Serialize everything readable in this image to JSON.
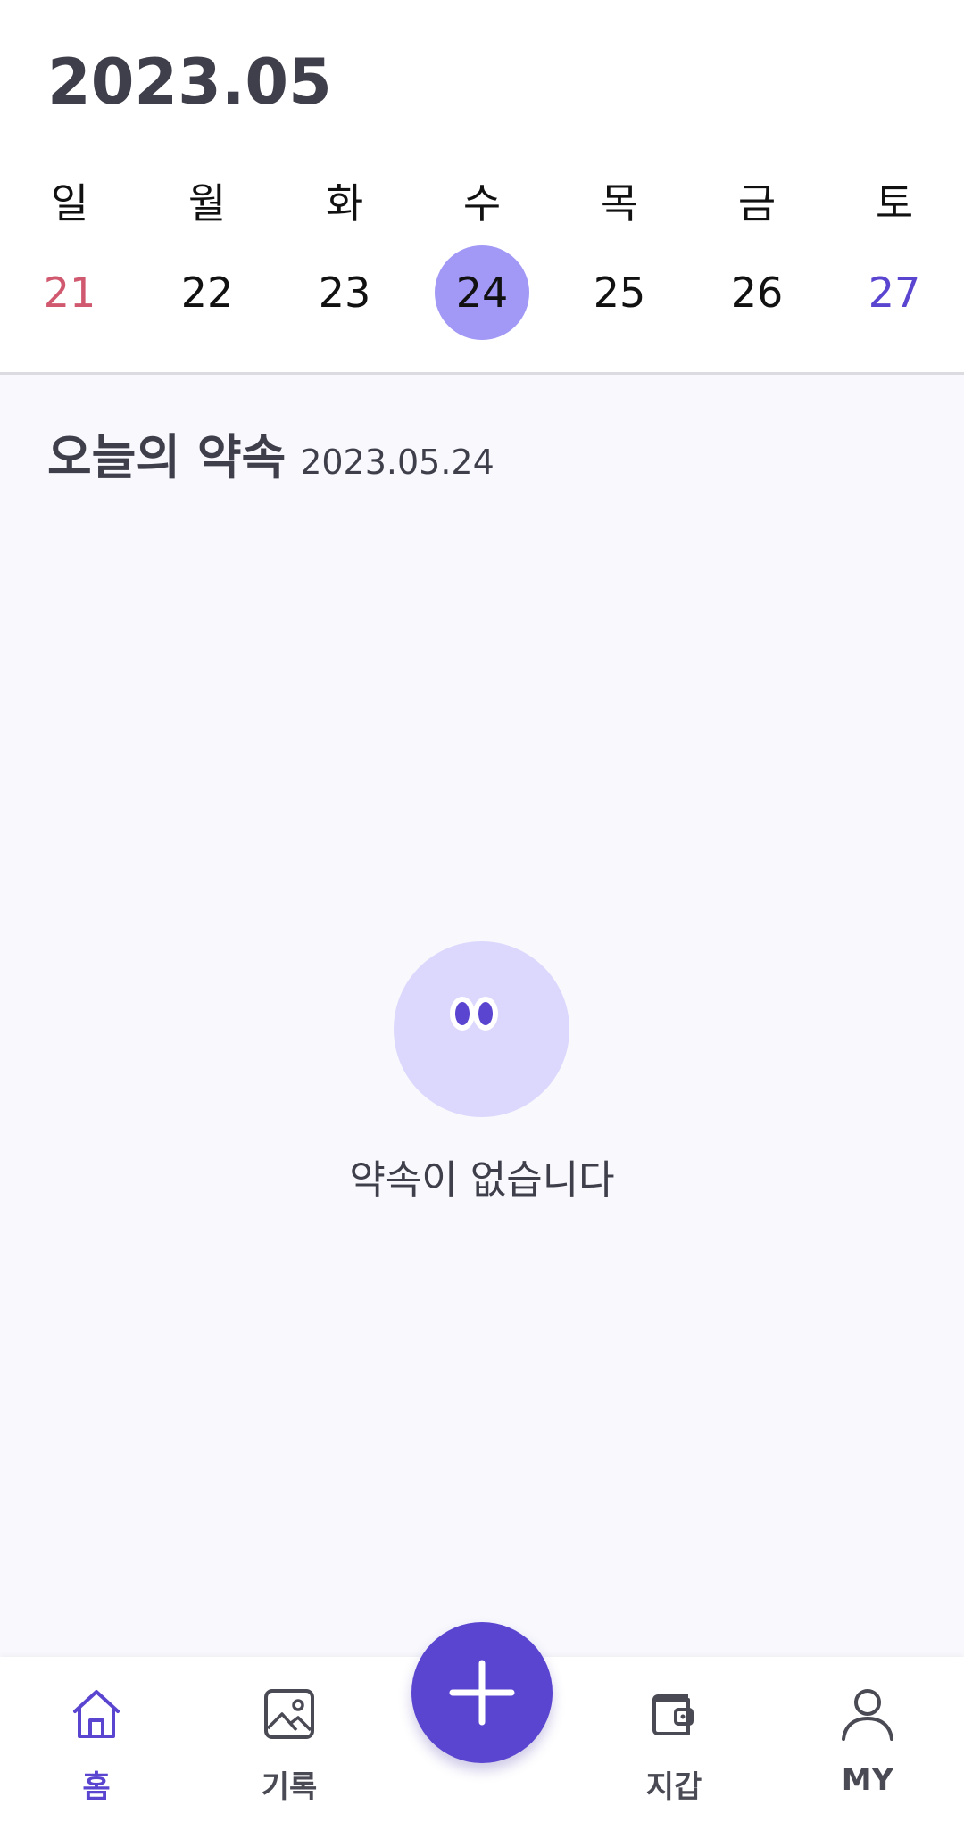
{
  "header": {
    "month_title": "2023.05",
    "weekdays": [
      "일",
      "월",
      "화",
      "수",
      "목",
      "금",
      "토"
    ],
    "dates": [
      "21",
      "22",
      "23",
      "24",
      "25",
      "26",
      "27"
    ],
    "selected_date": "24"
  },
  "today": {
    "title": "오늘의 약속",
    "date": "2023.05.24"
  },
  "empty_state": {
    "message": "약속이 없습니다"
  },
  "tabbar": {
    "items": [
      {
        "label": "홈",
        "icon": "home-icon",
        "active": true
      },
      {
        "label": "기록",
        "icon": "image-icon",
        "active": false
      },
      {
        "label": "지갑",
        "icon": "wallet-icon",
        "active": false
      },
      {
        "label": "MY",
        "icon": "person-icon",
        "active": false
      }
    ],
    "fab_icon": "plus-icon"
  },
  "colors": {
    "accent": "#5a45d0",
    "selected_date_bg": "#a199f5",
    "sunday": "#d0586f",
    "saturday": "#5a45d0",
    "content_bg": "#f8f8fd",
    "empty_face": "#dcd8fd"
  }
}
